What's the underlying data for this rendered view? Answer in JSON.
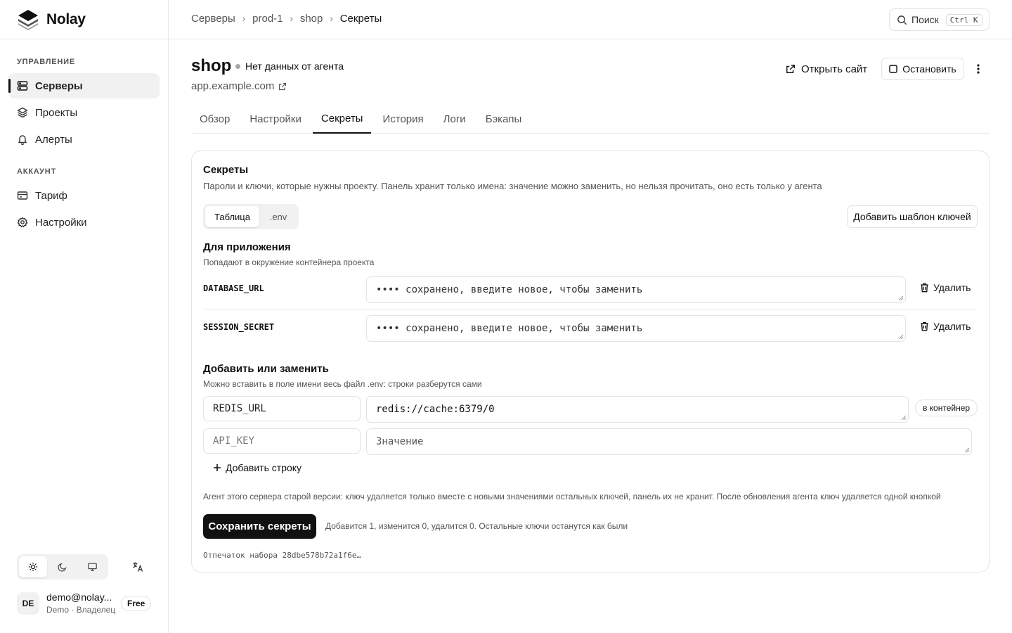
{
  "app": {
    "name": "Nolay"
  },
  "sidebar": {
    "sections": [
      {
        "title": "УПРАВЛЕНИЕ"
      },
      {
        "title": "АККАУНТ"
      }
    ],
    "items": [
      {
        "label": "Серверы",
        "icon": "server-icon",
        "active": true
      },
      {
        "label": "Проекты",
        "icon": "layers-icon"
      },
      {
        "label": "Алерты",
        "icon": "bell-icon"
      },
      {
        "label": "Тариф",
        "icon": "card-icon"
      },
      {
        "label": "Настройки",
        "icon": "gear-icon"
      }
    ],
    "theme": {
      "selected": "light",
      "options": [
        "sun-icon",
        "moon-icon",
        "monitor-icon"
      ]
    },
    "language_icon": "translate-icon",
    "user": {
      "initials": "DE",
      "email": "demo@nolay...",
      "role": "Demo · Владелец",
      "plan": "Free"
    }
  },
  "topbar": {
    "breadcrumb": [
      "Серверы",
      "prod-1",
      "shop",
      "Секреты"
    ],
    "search": {
      "label": "Поиск",
      "shortcut": "Ctrl K"
    }
  },
  "header": {
    "title": "shop",
    "status": "Нет данных от агента",
    "domain": "app.example.com",
    "open_site": "Открыть сайт",
    "stop": "Остановить"
  },
  "tabs": [
    {
      "label": "Обзор"
    },
    {
      "label": "Настройки"
    },
    {
      "label": "Секреты",
      "active": true
    },
    {
      "label": "История"
    },
    {
      "label": "Логи"
    },
    {
      "label": "Бэкапы"
    }
  ],
  "secrets": {
    "title": "Секреты",
    "description": "Пароли и ключи, которые нужны проекту. Панель хранит только имена: значение можно заменить, но нельзя прочитать, оно есть только у агента",
    "view_toggle": {
      "options": [
        "Таблица",
        ".env"
      ],
      "selected": "Таблица"
    },
    "add_template": "Добавить шаблон ключей",
    "app_section": {
      "title": "Для приложения",
      "subtitle": "Попадают в окружение контейнера проекта",
      "rows": [
        {
          "key": "DATABASE_URL",
          "placeholder": "•••• сохранено, введите новое, чтобы заменить",
          "delete": "Удалить"
        },
        {
          "key": "SESSION_SECRET",
          "placeholder": "•••• сохранено, введите новое, чтобы заменить",
          "delete": "Удалить"
        }
      ]
    },
    "add_section": {
      "title": "Добавить или заменить",
      "subtitle": "Можно вставить в поле имени весь файл .env: строки разберутся сами",
      "rows": [
        {
          "name": "REDIS_URL",
          "value": "redis://cache:6379/0",
          "badge": "в контейнер"
        },
        {
          "name_placeholder": "API_KEY",
          "value_placeholder": "Значение"
        }
      ],
      "add_row": "Добавить строку"
    },
    "warning": "Агент этого сервера старой версии: ключ удаляется только вместе с новыми значениями остальных ключей, панель их не хранит. После обновления агента ключ удаляется одной кнопкой",
    "save_button": "Сохранить секреты",
    "save_note": "Добавится 1, изменится 0, удалится 0. Остальные ключи останутся как были",
    "fingerprint": "Отпечаток набора 28dbe578b72a1f6e…"
  }
}
